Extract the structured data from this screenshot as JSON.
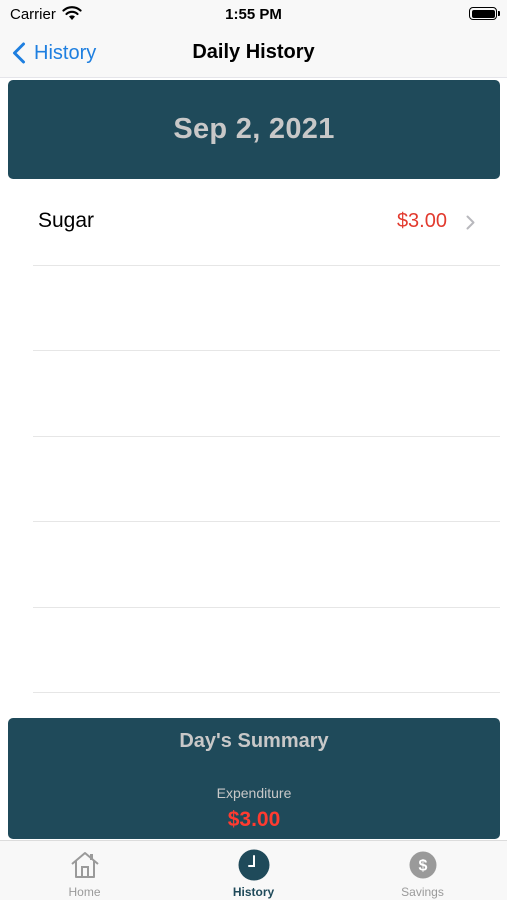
{
  "status_bar": {
    "carrier": "Carrier",
    "time": "1:55 PM"
  },
  "nav": {
    "back_label": "History",
    "title": "Daily History"
  },
  "date_header": {
    "date": "Sep 2, 2021"
  },
  "list": {
    "items": [
      {
        "name": "Sugar",
        "amount": "$3.00"
      }
    ],
    "empty_rows": 5
  },
  "summary": {
    "title": "Day's Summary",
    "label": "Expenditure",
    "value": "$3.00"
  },
  "tabs": [
    {
      "label": "Home",
      "icon": "home-icon",
      "active": false
    },
    {
      "label": "History",
      "icon": "clock-icon",
      "active": true
    },
    {
      "label": "Savings",
      "icon": "dollar-icon",
      "active": false
    }
  ],
  "colors": {
    "accent": "#1f4a5a",
    "link": "#1e7fe0",
    "expense": "#e23a2e",
    "header_text": "#c8c8c8"
  }
}
